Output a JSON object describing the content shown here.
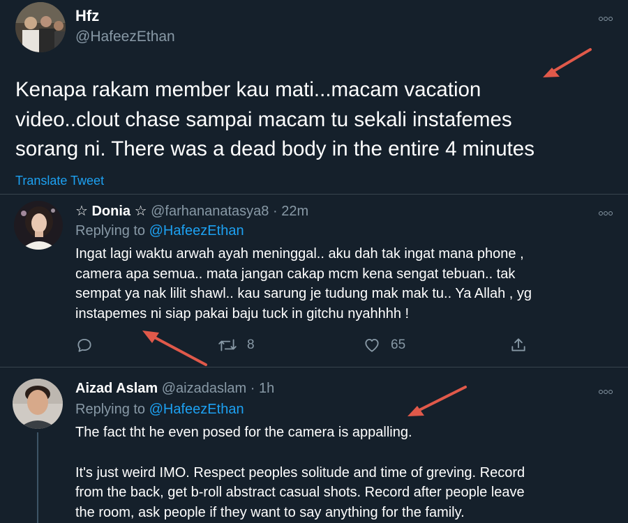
{
  "main_tweet": {
    "display_name": "Hfz",
    "handle": "@HafeezEthan",
    "text_lines": [
      "Kenapa rakam member kau mati...macam vacation",
      "video..clout chase sampai macam tu sekali instafemes",
      "sorang ni. There was a dead body in the entire 4 minutes"
    ],
    "translate_label": "Translate Tweet"
  },
  "reply1": {
    "display_name": "☆ Donia ☆",
    "handle": "@farhananatasya8",
    "separator": "·",
    "time": "22m",
    "replying_prefix": "Replying to",
    "replying_handle": "@HafeezEthan",
    "text_lines": [
      "Ingat lagi waktu arwah ayah meninggal.. aku dah tak ingat mana phone ,",
      "camera apa semua.. mata jangan cakap mcm kena sengat tebuan.. tak",
      "sempat ya nak lilit shawl.. kau sarung je tudung mak mak tu.. Ya Allah , yg",
      "instapemes ni siap pakai baju tuck in gitchu nyahhhh !"
    ],
    "retweet_count": "8",
    "like_count": "65"
  },
  "reply2": {
    "display_name": "Aizad Aslam",
    "handle": "@aizadaslam",
    "separator": "·",
    "time": "1h",
    "replying_prefix": "Replying to",
    "replying_handle": "@HafeezEthan",
    "text_line1": "The fact tht he even posed for the camera is appalling.",
    "text_lines": [
      "It's just weird IMO. Respect peoples solitude and time of greving. Record",
      "from the back, get b-roll abstract casual shots. Record after people leave",
      "the room, ask people if they want to say anything for the family."
    ]
  },
  "icons": {
    "more": "more-horizontal-icon",
    "reply": "reply-bubble-icon",
    "retweet": "retweet-icon",
    "like": "heart-icon",
    "share": "share-icon",
    "annotation": "red-arrow"
  },
  "colors": {
    "background": "#15202b",
    "text": "#ffffff",
    "muted": "#8899a6",
    "link": "#1da1f2",
    "divider": "#38444d",
    "annotation_arrow": "#e0594a"
  }
}
